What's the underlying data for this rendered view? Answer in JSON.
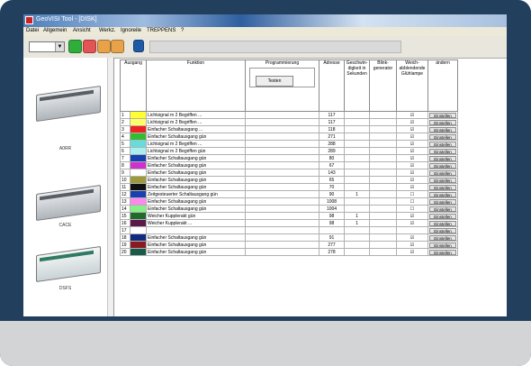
{
  "window": {
    "title": "GeoVISI Tool - [DISK]"
  },
  "menu": [
    "Datei",
    "Allgemein",
    "Ansicht",
    "Werkz.",
    "Ignoreile",
    "TREPPENS",
    "?"
  ],
  "toolbar": {
    "combo_value": "",
    "button_colors": [
      "#2fae3c",
      "#e35454",
      "#e7a24a",
      "#e7a24a",
      "#1f5aa6"
    ]
  },
  "devices": [
    {
      "label": "A0RR"
    },
    {
      "label": "CACE"
    },
    {
      "label": "DSFS"
    }
  ],
  "grid": {
    "headers": {
      "ausgang": "Ausgang",
      "funktion": "Funktion",
      "programmierung": "Programmierung",
      "pg_button": "Testen",
      "adresse": "Adresse",
      "geschwindigkeit": "Geschwin-digkeit in Sekunden",
      "blink": "Blink-generator",
      "weich": "Weich-abblendende Glühlampe",
      "andern": "ändern"
    },
    "edit_label": "Einstellen",
    "rows": [
      {
        "num": "1",
        "color": "#ffff33",
        "funktion": "Lichtsignal m 2 Begriffen ...",
        "adresse": "117",
        "geschw": "",
        "blink": "",
        "weich": "☑"
      },
      {
        "num": "2",
        "color": "#ffff66",
        "funktion": "Lichtsignal m 2 Begriffen ...",
        "adresse": "117",
        "geschw": "",
        "blink": "",
        "weich": "☑"
      },
      {
        "num": "3",
        "color": "#ee2222",
        "funktion": "Einfacher Schaltausgang ...",
        "adresse": "118",
        "geschw": "",
        "blink": "",
        "weich": "☑"
      },
      {
        "num": "4",
        "color": "#33bb33",
        "funktion": "Einfacher Schaltausgang gün",
        "adresse": "271",
        "geschw": "",
        "blink": "",
        "weich": "☑"
      },
      {
        "num": "5",
        "color": "#66dddd",
        "funktion": "Lichtsignal m 2 Begriffen ...",
        "adresse": "288",
        "geschw": "",
        "blink": "",
        "weich": "☑"
      },
      {
        "num": "6",
        "color": "#aaeeee",
        "funktion": "Lichtsignal m 2 Begriffen gün",
        "adresse": "289",
        "geschw": "",
        "blink": "",
        "weich": "☑"
      },
      {
        "num": "7",
        "color": "#1a3fb0",
        "funktion": "Einfacher Schaltausgang gün",
        "adresse": "80",
        "geschw": "",
        "blink": "",
        "weich": "☑"
      },
      {
        "num": "8",
        "color": "#cc33cc",
        "funktion": "Einfacher Schaltausgang gün",
        "adresse": "67",
        "geschw": "",
        "blink": "",
        "weich": "☑"
      },
      {
        "num": "9",
        "color": "#ffffff",
        "funktion": "Einfacher Schaltausgang gün",
        "adresse": "143",
        "geschw": "",
        "blink": "",
        "weich": "☑"
      },
      {
        "num": "10",
        "color": "#9e9a3a",
        "funktion": "Einfacher Schaltausgang gün",
        "adresse": "65",
        "geschw": "",
        "blink": "",
        "weich": "☑"
      },
      {
        "num": "11",
        "color": "#111111",
        "funktion": "Einfacher Schaltausgang gün",
        "adresse": "70",
        "geschw": "",
        "blink": "",
        "weich": "☑"
      },
      {
        "num": "12",
        "color": "#1a3fb0",
        "funktion": "Zeitgesteuerter Schaltausgang gün",
        "adresse": "90",
        "geschw": "1",
        "blink": "",
        "weich": "☐"
      },
      {
        "num": "13",
        "color": "#ff88ee",
        "funktion": "Einfacher Schaltausgang gün",
        "adresse": "1008",
        "geschw": "",
        "blink": "",
        "weich": "☐"
      },
      {
        "num": "14",
        "color": "#88ee88",
        "funktion": "Einfacher Schaltausgang gün",
        "adresse": "1004",
        "geschw": "",
        "blink": "",
        "weich": "☐"
      },
      {
        "num": "15",
        "color": "#1f6a2a",
        "funktion": "Weicher Kupplerakt gün",
        "adresse": "98",
        "geschw": "1",
        "blink": "",
        "weich": "☑"
      },
      {
        "num": "16",
        "color": "#5c1a4a",
        "funktion": "Weicher Kupplerakt ...",
        "adresse": "98",
        "geschw": "1",
        "blink": "",
        "weich": "☑"
      },
      {
        "num": "17",
        "color": "#ffffff",
        "funktion": "",
        "adresse": "",
        "geschw": "",
        "blink": "",
        "weich": ""
      },
      {
        "num": "18",
        "color": "#0f2a80",
        "funktion": "Einfacher Schaltausgang gün",
        "adresse": "91",
        "geschw": "",
        "blink": "",
        "weich": "☑"
      },
      {
        "num": "19",
        "color": "#8a1a22",
        "funktion": "Einfacher Schaltausgang gün",
        "adresse": "277",
        "geschw": "",
        "blink": "",
        "weich": "☑"
      },
      {
        "num": "20",
        "color": "#1a5a4a",
        "funktion": "Einfacher Schaltausgang gün",
        "adresse": "278",
        "geschw": "",
        "blink": "",
        "weich": "☑"
      }
    ]
  },
  "colors": {
    "frame": "#233f5e",
    "bottom_band": "#d2d4d6"
  }
}
